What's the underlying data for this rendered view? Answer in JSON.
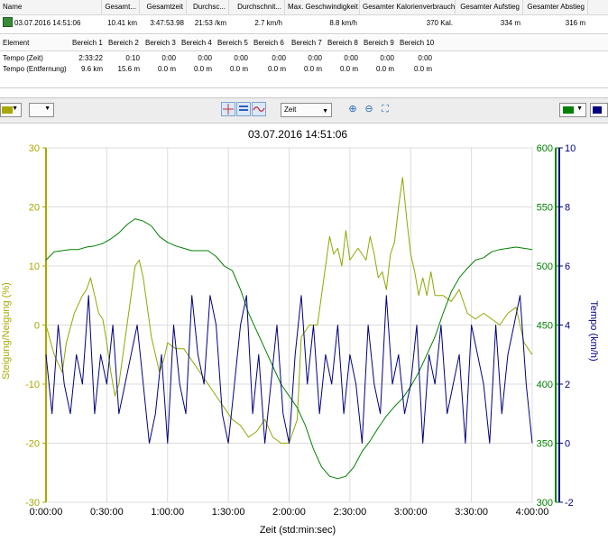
{
  "summary": {
    "columns": [
      "Name",
      "Gesamt...",
      "Gesamtzeit",
      "Durchsc...",
      "Durchschnit...",
      "Max. Geschwindigkeit",
      "Gesamter Kalorienverbrauch",
      "Gesamter Aufstieg",
      "Gesamter Abstieg"
    ],
    "row": [
      "03.07.2016 14:51:06",
      "10.41 km",
      "3:47:53.98",
      "21:53 /km",
      "2.7 km/h",
      "8.8 km/h",
      "370 Kal.",
      "334 m",
      "316 m"
    ]
  },
  "zones": {
    "header": [
      "Element",
      "Bereich 1",
      "Bereich 2",
      "Bereich 3",
      "Bereich 4",
      "Bereich 5",
      "Bereich 6",
      "Bereich 7",
      "Bereich 8",
      "Bereich 9",
      "Bereich 10"
    ],
    "rows": [
      [
        "Tempo (Zeit)",
        "2:33:22",
        "0:10",
        "0:00",
        "0:00",
        "0:00",
        "0:00",
        "0:00",
        "0:00",
        "0:00",
        "0:00"
      ],
      [
        "Tempo (Entfernung)",
        "9.6 km",
        "15.6 m",
        "0.0 m",
        "0.0 m",
        "0.0 m",
        "0.0 m",
        "0.0 m",
        "0.0 m",
        "0.0 m",
        "0.0 m"
      ]
    ]
  },
  "toolbar": {
    "axis_select": "Zeit",
    "left_color": "#a8a800",
    "right_color1": "#008000",
    "right_color2": "#000080",
    "icons": [
      "cursor-cross-icon",
      "bars-icon",
      "wave-icon",
      "zoom-in-icon",
      "zoom-out-icon",
      "zoom-fit-icon"
    ]
  },
  "chart_data": {
    "type": "line",
    "title": "03.07.2016 14:51:06",
    "xlabel": "Zeit (std:min:sec)",
    "ylabel_left": "Steigung/Neigung (%)",
    "ylabel_right": "Tempo (km/h)",
    "x_ticks": [
      "0:00:00",
      "0:30:00",
      "1:00:00",
      "1:30:00",
      "2:00:00",
      "2:30:00",
      "3:00:00",
      "3:30:00",
      "4:00:00"
    ],
    "x_range_min": [
      0,
      240
    ],
    "y_left": {
      "range": [
        -30,
        30
      ],
      "ticks": [
        -30,
        -20,
        -10,
        0,
        10,
        20,
        30
      ],
      "color": "#a8a800"
    },
    "y_mid": {
      "range": [
        300,
        600
      ],
      "ticks": [
        300,
        350,
        400,
        450,
        500,
        550,
        600
      ],
      "color": "#008000"
    },
    "y_right": {
      "range": [
        -2,
        10
      ],
      "ticks": [
        -2,
        0,
        2,
        4,
        6,
        8,
        10
      ],
      "color": "#000080"
    },
    "series": [
      {
        "color": "#8fa800",
        "axis": "left",
        "x": [
          0,
          4,
          8,
          10,
          14,
          18,
          20,
          22,
          24,
          26,
          28,
          30,
          32,
          34,
          36,
          38,
          40,
          42,
          44,
          46,
          48,
          50,
          52,
          54,
          56,
          58,
          60,
          64,
          68,
          72,
          76,
          80,
          84,
          88,
          92,
          96,
          100,
          104,
          108,
          112,
          116,
          120,
          124,
          126,
          128,
          130,
          132,
          134,
          136,
          138,
          140,
          142,
          144,
          146,
          148,
          150,
          152,
          154,
          156,
          158,
          160,
          162,
          164,
          166,
          168,
          170,
          172,
          174,
          176,
          178,
          180,
          182,
          184,
          186,
          188,
          190,
          192,
          196,
          200,
          204,
          208,
          212,
          216,
          220,
          224,
          228,
          232,
          236,
          240
        ],
        "values": [
          0,
          -5,
          -8,
          -3,
          2,
          5,
          6,
          8,
          5,
          2,
          1,
          -3,
          -8,
          -12,
          -10,
          -5,
          0,
          5,
          10,
          11,
          8,
          3,
          -2,
          -5,
          -8,
          -6,
          -3,
          -4,
          -4,
          -6,
          -8,
          -10,
          -12,
          -14,
          -16,
          -17,
          -19,
          -18,
          -16,
          -19,
          -20,
          -20,
          -16,
          -2,
          -1,
          0,
          0,
          0,
          5,
          10,
          15,
          12,
          13,
          10,
          16,
          11,
          12,
          13,
          12,
          11,
          15,
          12,
          8,
          9,
          6,
          12,
          14,
          20,
          25,
          18,
          12,
          9,
          5,
          8,
          5,
          9,
          5,
          5,
          4,
          6,
          2,
          1,
          2,
          1,
          0,
          2,
          3,
          -3,
          -5
        ]
      },
      {
        "color": "#008000",
        "axis": "mid",
        "x": [
          0,
          4,
          8,
          12,
          16,
          20,
          24,
          28,
          32,
          36,
          40,
          44,
          48,
          52,
          56,
          60,
          64,
          68,
          72,
          76,
          80,
          84,
          88,
          92,
          96,
          100,
          104,
          108,
          112,
          116,
          120,
          124,
          128,
          132,
          136,
          140,
          144,
          148,
          152,
          156,
          160,
          164,
          168,
          172,
          176,
          180,
          184,
          188,
          192,
          196,
          200,
          204,
          208,
          212,
          216,
          220,
          224,
          228,
          232,
          236,
          240
        ],
        "values": [
          505,
          512,
          513,
          514,
          514,
          516,
          517,
          519,
          523,
          528,
          535,
          540,
          538,
          534,
          525,
          520,
          517,
          515,
          513,
          513,
          513,
          508,
          500,
          496,
          480,
          460,
          445,
          430,
          415,
          400,
          390,
          380,
          365,
          345,
          330,
          322,
          320,
          322,
          330,
          343,
          352,
          363,
          373,
          381,
          388,
          398,
          410,
          425,
          440,
          460,
          478,
          490,
          498,
          505,
          507,
          512,
          514,
          515,
          516,
          515,
          514
        ]
      },
      {
        "color": "#000080",
        "axis": "right",
        "x": [
          0,
          3,
          6,
          9,
          12,
          15,
          18,
          21,
          24,
          27,
          30,
          33,
          36,
          39,
          42,
          45,
          48,
          51,
          54,
          57,
          60,
          63,
          66,
          69,
          72,
          75,
          78,
          81,
          84,
          87,
          90,
          93,
          96,
          99,
          102,
          105,
          108,
          111,
          114,
          117,
          120,
          123,
          126,
          129,
          132,
          135,
          138,
          141,
          144,
          147,
          150,
          153,
          156,
          159,
          162,
          165,
          168,
          171,
          174,
          177,
          180,
          183,
          186,
          189,
          192,
          195,
          198,
          201,
          204,
          207,
          210,
          213,
          216,
          219,
          222,
          225,
          228,
          231,
          234,
          237,
          240
        ],
        "values": [
          3,
          1,
          4,
          2,
          1,
          3,
          2,
          5,
          1,
          3,
          2,
          4,
          1,
          2,
          3,
          4,
          2,
          0,
          1,
          3,
          0,
          4,
          2,
          1,
          5,
          3,
          2,
          5,
          4,
          1,
          0,
          2,
          4,
          5,
          1,
          3,
          0,
          2,
          4,
          1,
          0,
          3,
          5,
          2,
          4,
          1,
          3,
          2,
          4,
          1,
          3,
          2,
          0,
          4,
          2,
          1,
          5,
          2,
          3,
          1,
          2,
          4,
          0,
          3,
          2,
          4,
          1,
          2,
          3,
          0,
          4,
          3,
          2,
          0,
          4,
          1,
          3,
          4,
          5,
          2,
          0
        ]
      }
    ],
    "grid": true
  }
}
